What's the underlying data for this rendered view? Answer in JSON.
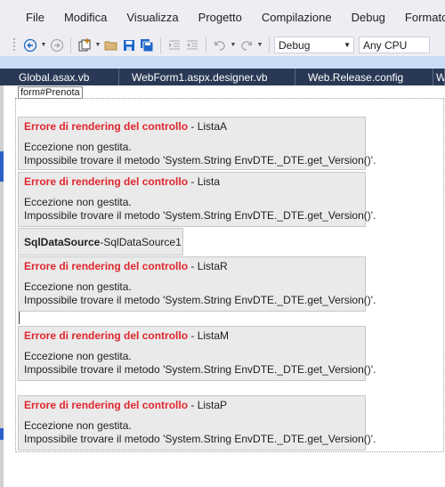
{
  "menu": {
    "items": [
      "File",
      "Modifica",
      "Visualizza",
      "Progetto",
      "Compilazione",
      "Debug",
      "Formato"
    ]
  },
  "toolbar": {
    "icons": [
      "back-icon",
      "forward-icon",
      "new-project-icon",
      "open-folder-icon",
      "save-icon",
      "save-all-icon",
      "indent-icon",
      "outdent-icon",
      "undo-icon",
      "redo-icon"
    ],
    "configuration": "Debug",
    "platform": "Any CPU"
  },
  "tabs": [
    "Global.asax.vb",
    "WebForm1.aspx.designer.vb",
    "Web.Release.config",
    "W"
  ],
  "designer": {
    "form_tag": "form#Prenota",
    "controls": [
      {
        "error": "Errore di rendering del controllo",
        "sep": " - ",
        "name": "ListaA",
        "line1": "Eccezione non gestita.",
        "line2": "Impossibile trovare il metodo 'System.String EnvDTE._DTE.get_Version()'."
      },
      {
        "error": "Errore di rendering del controllo",
        "sep": " - ",
        "name": "Lista",
        "line1": "Eccezione non gestita.",
        "line2": "Impossibile trovare il metodo 'System.String EnvDTE._DTE.get_Version()'."
      },
      {
        "error": "Errore di rendering del controllo",
        "sep": " - ",
        "name": "ListaR",
        "line1": "Eccezione non gestita.",
        "line2": "Impossibile trovare il metodo 'System.String EnvDTE._DTE.get_Version()'."
      },
      {
        "error": "Errore di rendering del controllo",
        "sep": " - ",
        "name": "ListaM",
        "line1": "Eccezione non gestita.",
        "line2": "Impossibile trovare il metodo 'System.String EnvDTE._DTE.get_Version()'."
      },
      {
        "error": "Errore di rendering del controllo",
        "sep": " - ",
        "name": "ListaP",
        "line1": "Eccezione non gestita.",
        "line2": "Impossibile trovare il metodo 'System.String EnvDTE._DTE.get_Version()'."
      }
    ],
    "sql": {
      "type": "SqlDataSource",
      "sep": " - ",
      "name": "SqlDataSource1"
    }
  },
  "colors": {
    "error": "#e0262e",
    "tabbar": "#293955",
    "chrome": "#eeeef2",
    "vs_purple": "#68217a"
  }
}
